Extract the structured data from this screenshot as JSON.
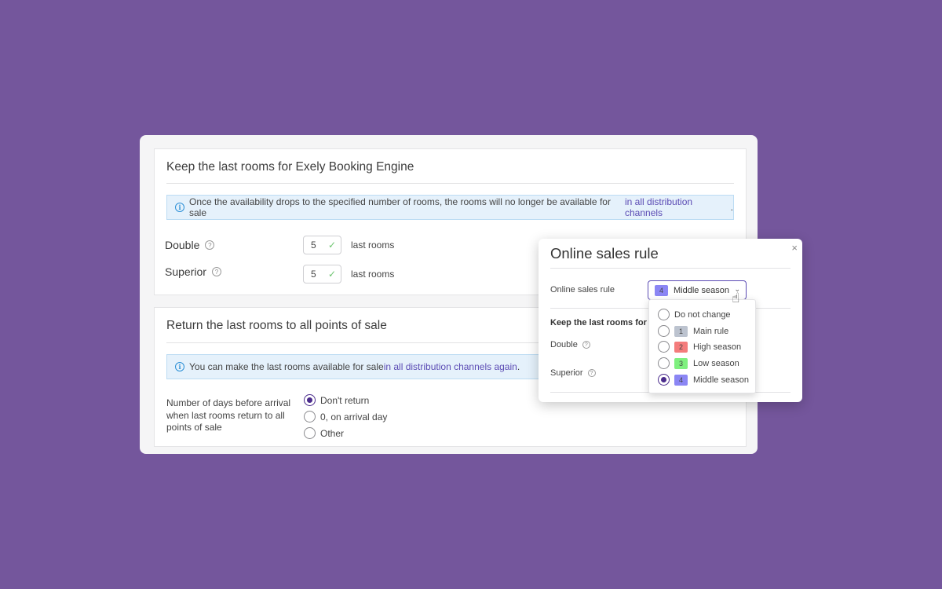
{
  "section_keep": {
    "title": "Keep the last rooms for Exely Booking Engine",
    "info_text": "Once the availability drops to the specified number of rooms, the rooms will no longer be available for sale",
    "info_link": "in all distribution channels",
    "info_end": ".",
    "rooms": [
      {
        "label": "Double",
        "value": "5",
        "suffix": "last rooms"
      },
      {
        "label": "Superior",
        "value": "5",
        "suffix": "last rooms"
      }
    ]
  },
  "section_return": {
    "title": "Return the last rooms to all points of sale",
    "info_text": "You can make the last rooms available for sale",
    "info_link": "in all distribution channels again",
    "info_end": ".",
    "days_label": "Number of days before arrival when last rooms return to all points of sale",
    "options": [
      {
        "label": "Don't return",
        "selected": true
      },
      {
        "label": "0, on arrival day",
        "selected": false
      },
      {
        "label": "Other",
        "selected": false
      }
    ]
  },
  "modal": {
    "title": "Online sales rule",
    "close": "×",
    "rule_label": "Online sales rule",
    "selected": {
      "number": "4",
      "label": "Middle season",
      "color": "#8b86f4"
    },
    "subtitle": "Keep the last rooms for l",
    "rooms": [
      {
        "label": "Double"
      },
      {
        "label": "Superior"
      }
    ]
  },
  "dropdown": {
    "options": [
      {
        "label": "Do not change",
        "number": "",
        "color": "",
        "selected": false
      },
      {
        "label": "Main rule",
        "number": "1",
        "color": "#bcc3cf",
        "selected": false
      },
      {
        "label": "High season",
        "number": "2",
        "color": "#f47c7c",
        "selected": false
      },
      {
        "label": "Low season",
        "number": "3",
        "color": "#7ff07f",
        "selected": false
      },
      {
        "label": "Middle season",
        "number": "4",
        "color": "#8b86f4",
        "selected": true
      }
    ]
  },
  "icons": {
    "info": "i",
    "help": "?",
    "check": "✓",
    "chevron": "⌄",
    "cursor": "☝"
  },
  "colors": {
    "background": "#74569c",
    "accent": "#4b2c8c",
    "link": "#5b4bb4",
    "info_bg": "#e5f1fb",
    "success": "#6cc46f"
  }
}
